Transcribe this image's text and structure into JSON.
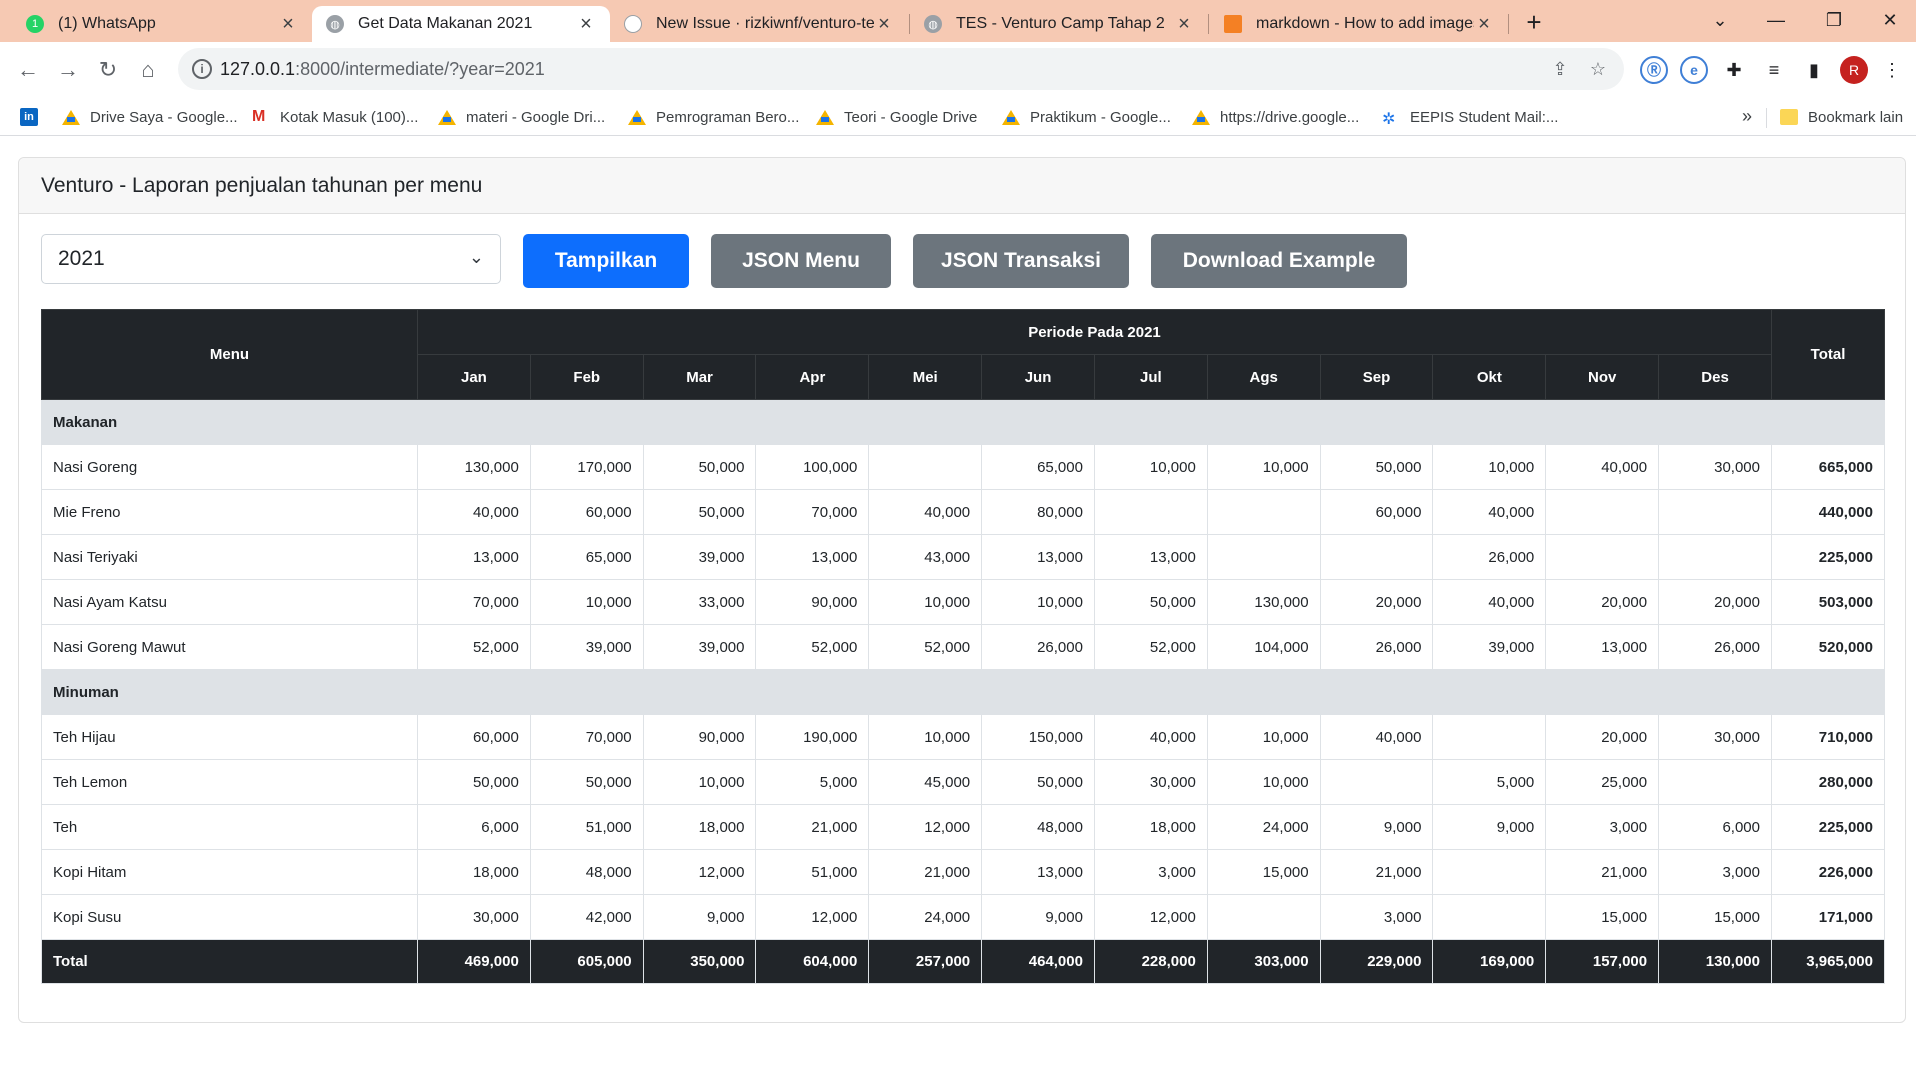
{
  "browser": {
    "tabs": [
      {
        "label": "(1) WhatsApp",
        "icon": "whatsapp-icon"
      },
      {
        "label": "Get Data Makanan 2021",
        "icon": "globe-icon"
      },
      {
        "label": "New Issue · rizkiwnf/venturo-test",
        "icon": "github-icon"
      },
      {
        "label": "TES - Venturo Camp Tahap 2",
        "icon": "globe-icon"
      },
      {
        "label": "markdown - How to add images",
        "icon": "stackoverflow-icon"
      }
    ],
    "url_host": "127.0.0.1",
    "url_path": ":8000/intermediate/?year=2021",
    "profile_initial": "R",
    "bookmarks": [
      {
        "label": "Drive Saya - Google...",
        "icon": "google-drive-icon"
      },
      {
        "label": "Kotak Masuk (100)...",
        "icon": "gmail-icon"
      },
      {
        "label": "materi - Google Dri...",
        "icon": "google-drive-icon"
      },
      {
        "label": "Pemrograman Bero...",
        "icon": "google-drive-icon"
      },
      {
        "label": "Teori - Google Drive",
        "icon": "google-drive-icon"
      },
      {
        "label": "Praktikum - Google...",
        "icon": "google-drive-icon"
      },
      {
        "label": "https://drive.google...",
        "icon": "google-drive-icon"
      },
      {
        "label": "EEPIS Student Mail:...",
        "icon": "eepis-icon"
      }
    ],
    "bookmarks_more": "»",
    "other_bookmarks": "Bookmark lain"
  },
  "page": {
    "title": "Venturo - Laporan penjualan tahunan per menu",
    "year_select": "2021",
    "buttons": {
      "show": "Tampilkan",
      "json_menu": "JSON Menu",
      "json_transaksi": "JSON Transaksi",
      "download": "Download Example"
    }
  },
  "table": {
    "menu_header": "Menu",
    "period_header": "Periode Pada 2021",
    "total_header": "Total",
    "months": [
      "Jan",
      "Feb",
      "Mar",
      "Apr",
      "Mei",
      "Jun",
      "Jul",
      "Ags",
      "Sep",
      "Okt",
      "Nov",
      "Des"
    ],
    "groups": [
      {
        "name": "Makanan",
        "rows": [
          {
            "name": "Nasi Goreng",
            "values": [
              "130,000",
              "170,000",
              "50,000",
              "100,000",
              "",
              "65,000",
              "10,000",
              "10,000",
              "50,000",
              "10,000",
              "40,000",
              "30,000"
            ],
            "total": "665,000"
          },
          {
            "name": "Mie Freno",
            "values": [
              "40,000",
              "60,000",
              "50,000",
              "70,000",
              "40,000",
              "80,000",
              "",
              "",
              "60,000",
              "40,000",
              "",
              ""
            ],
            "total": "440,000"
          },
          {
            "name": "Nasi Teriyaki",
            "values": [
              "13,000",
              "65,000",
              "39,000",
              "13,000",
              "43,000",
              "13,000",
              "13,000",
              "",
              "",
              "26,000",
              "",
              ""
            ],
            "total": "225,000"
          },
          {
            "name": "Nasi Ayam Katsu",
            "values": [
              "70,000",
              "10,000",
              "33,000",
              "90,000",
              "10,000",
              "10,000",
              "50,000",
              "130,000",
              "20,000",
              "40,000",
              "20,000",
              "20,000"
            ],
            "total": "503,000"
          },
          {
            "name": "Nasi Goreng Mawut",
            "values": [
              "52,000",
              "39,000",
              "39,000",
              "52,000",
              "52,000",
              "26,000",
              "52,000",
              "104,000",
              "26,000",
              "39,000",
              "13,000",
              "26,000"
            ],
            "total": "520,000"
          }
        ]
      },
      {
        "name": "Minuman",
        "rows": [
          {
            "name": "Teh Hijau",
            "values": [
              "60,000",
              "70,000",
              "90,000",
              "190,000",
              "10,000",
              "150,000",
              "40,000",
              "10,000",
              "40,000",
              "",
              "20,000",
              "30,000"
            ],
            "total": "710,000"
          },
          {
            "name": "Teh Lemon",
            "values": [
              "50,000",
              "50,000",
              "10,000",
              "5,000",
              "45,000",
              "50,000",
              "30,000",
              "10,000",
              "",
              "5,000",
              "25,000",
              ""
            ],
            "total": "280,000"
          },
          {
            "name": "Teh",
            "values": [
              "6,000",
              "51,000",
              "18,000",
              "21,000",
              "12,000",
              "48,000",
              "18,000",
              "24,000",
              "9,000",
              "9,000",
              "3,000",
              "6,000"
            ],
            "total": "225,000"
          },
          {
            "name": "Kopi Hitam",
            "values": [
              "18,000",
              "48,000",
              "12,000",
              "51,000",
              "21,000",
              "13,000",
              "3,000",
              "15,000",
              "21,000",
              "",
              "21,000",
              "3,000"
            ],
            "total": "226,000"
          },
          {
            "name": "Kopi Susu",
            "values": [
              "30,000",
              "42,000",
              "9,000",
              "12,000",
              "24,000",
              "9,000",
              "12,000",
              "",
              "3,000",
              "",
              "15,000",
              "15,000"
            ],
            "total": "171,000"
          }
        ]
      }
    ],
    "footer": {
      "label": "Total",
      "values": [
        "469,000",
        "605,000",
        "350,000",
        "604,000",
        "257,000",
        "464,000",
        "228,000",
        "303,000",
        "229,000",
        "169,000",
        "157,000",
        "130,000"
      ],
      "total": "3,965,000"
    }
  }
}
